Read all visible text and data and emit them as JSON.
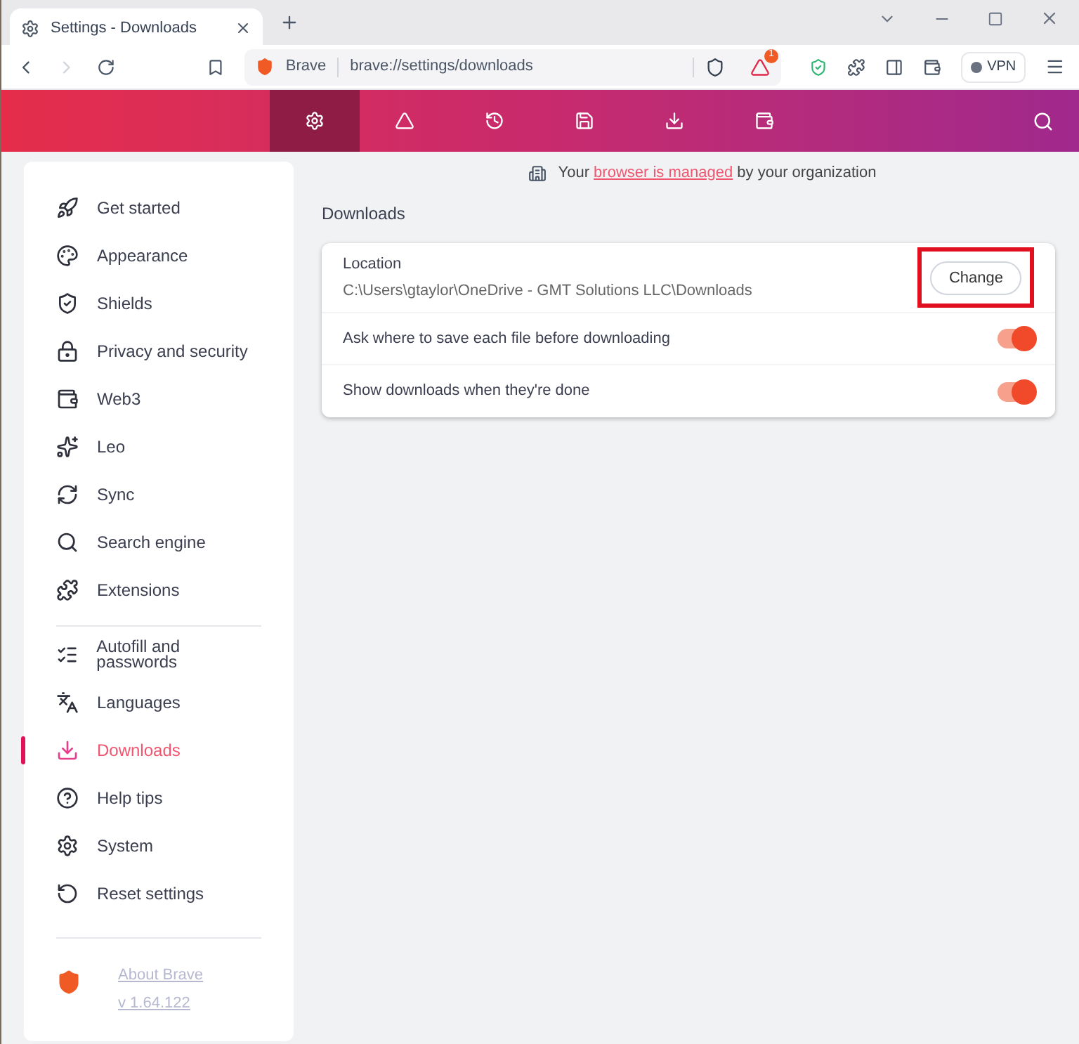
{
  "browser_tab": {
    "title": "Settings - Downloads"
  },
  "address_bar": {
    "site": "Brave",
    "url": "brave://settings/downloads"
  },
  "toolbar": {
    "rewards_badge": "1",
    "vpn_label": "VPN"
  },
  "header_tabs": [
    {
      "selected": true
    },
    {
      "selected": false
    },
    {
      "selected": false
    },
    {
      "selected": false
    },
    {
      "selected": false
    },
    {
      "selected": false
    }
  ],
  "sidebar": {
    "groups": [
      [
        {
          "label": "Get started",
          "selected": false
        },
        {
          "label": "Appearance",
          "selected": false
        },
        {
          "label": "Shields",
          "selected": false
        },
        {
          "label": "Privacy and security",
          "selected": false
        },
        {
          "label": "Web3",
          "selected": false
        },
        {
          "label": "Leo",
          "selected": false
        },
        {
          "label": "Sync",
          "selected": false
        },
        {
          "label": "Search engine",
          "selected": false
        },
        {
          "label": "Extensions",
          "selected": false
        }
      ],
      [
        {
          "label": "Autofill and passwords",
          "selected": false
        },
        {
          "label": "Languages",
          "selected": false
        },
        {
          "label": "Downloads",
          "selected": true
        },
        {
          "label": "Help tips",
          "selected": false
        },
        {
          "label": "System",
          "selected": false
        },
        {
          "label": "Reset settings",
          "selected": false
        }
      ]
    ],
    "about_link": "About Brave",
    "version": "v 1.64.122"
  },
  "managed_notice": {
    "before": "Your",
    "link": "browser is managed",
    "after": "by your organization"
  },
  "section_title": "Downloads",
  "location": {
    "label": "Location",
    "path": "C:\\Users\\gtaylor\\OneDrive - GMT Solutions LLC\\Downloads",
    "button": "Change",
    "highlighted": true
  },
  "settings": [
    {
      "label": "Ask where to save each file before downloading",
      "on": true
    },
    {
      "label": "Show downloads when they're done",
      "on": true
    }
  ]
}
